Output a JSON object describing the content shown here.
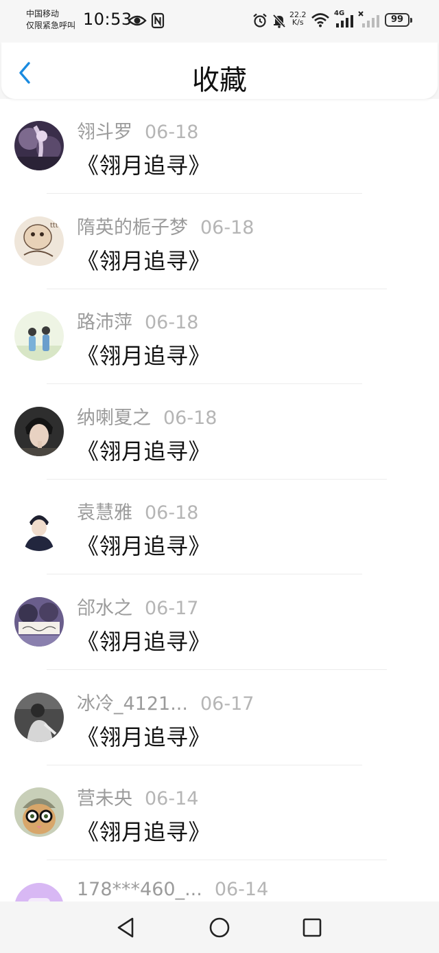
{
  "status_bar": {
    "carrier_line1": "中国移动",
    "carrier_line2": "仅限紧急呼叫",
    "time": "10:53",
    "net_speed_value": "22.2",
    "net_speed_unit": "K/s",
    "network_type": "4G",
    "battery": "99"
  },
  "header": {
    "title": "收藏",
    "back_icon": "chevron-left-icon",
    "accent_color": "#1a8be0"
  },
  "favorites": [
    {
      "user": "翎斗罗",
      "date": "06-18",
      "book": "《翎月追寻》"
    },
    {
      "user": "隋英的栀子梦",
      "date": "06-18",
      "book": "《翎月追寻》"
    },
    {
      "user": "路沛萍",
      "date": "06-18",
      "book": "《翎月追寻》"
    },
    {
      "user": "纳喇夏之",
      "date": "06-18",
      "book": "《翎月追寻》"
    },
    {
      "user": "袁慧雅",
      "date": "06-18",
      "book": "《翎月追寻》"
    },
    {
      "user": "郃水之",
      "date": "06-17",
      "book": "《翎月追寻》"
    },
    {
      "user": "冰冷_4121...",
      "date": "06-17",
      "book": "《翎月追寻》"
    },
    {
      "user": "营未央",
      "date": "06-14",
      "book": "《翎月追寻》"
    },
    {
      "user": "178***460_...",
      "date": "06-14",
      "book": ""
    }
  ],
  "system_nav": {
    "back": "triangle-back-icon",
    "home": "circle-home-icon",
    "recents": "square-recents-icon"
  }
}
